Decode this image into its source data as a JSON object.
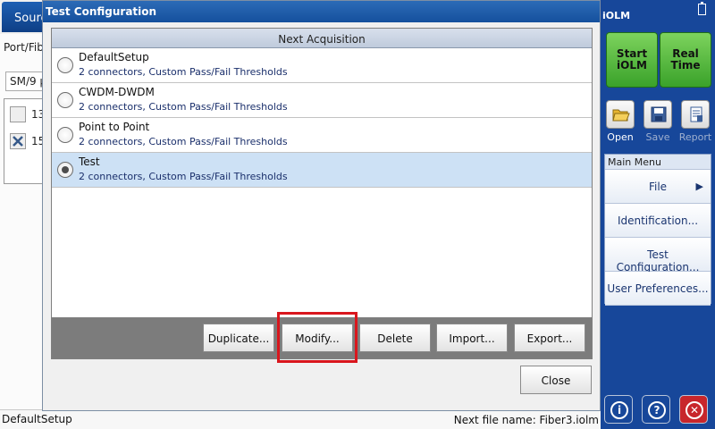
{
  "background": {
    "tab_label": "Sourc",
    "port_label": "Port/Fib",
    "fiber_select": "SM/9 µ",
    "wavelengths": [
      {
        "label": "13",
        "checked": false
      },
      {
        "label": "15",
        "checked": true
      }
    ]
  },
  "dialog": {
    "title": "Test Configuration",
    "list_header": "Next Acquisition",
    "items": [
      {
        "name": "DefaultSetup",
        "description": "2 connectors, Custom Pass/Fail Thresholds",
        "selected": false
      },
      {
        "name": "CWDM-DWDM",
        "description": "2 connectors, Custom Pass/Fail Thresholds",
        "selected": false
      },
      {
        "name": "Point to Point",
        "description": "2 connectors, Custom Pass/Fail Thresholds",
        "selected": false
      },
      {
        "name": "Test",
        "description": "2 connectors, Custom Pass/Fail Thresholds",
        "selected": true
      }
    ],
    "buttons": {
      "duplicate": "Duplicate...",
      "modify": "Modify...",
      "delete": "Delete",
      "import": "Import...",
      "export": "Export...",
      "close": "Close"
    }
  },
  "status": {
    "left": "DefaultSetup",
    "right": "Next file name: Fiber3.iolm"
  },
  "right_panel": {
    "title": "iOLM",
    "start_button": "Start iOLM",
    "start_line1": "Start",
    "start_line2": "iOLM",
    "real_line1": "Real",
    "real_line2": "Time",
    "tools": {
      "open": "Open",
      "save": "Save",
      "report": "Report"
    },
    "menu_title": "Main Menu",
    "menu_items": [
      "File",
      "Identification...",
      "Test Configuration...",
      "User Preferences..."
    ],
    "icons": [
      "info-icon",
      "help-icon",
      "exit-icon"
    ],
    "colors": {
      "panel": "#17479a",
      "start": "#4db33a",
      "exit": "#c8262b"
    }
  }
}
